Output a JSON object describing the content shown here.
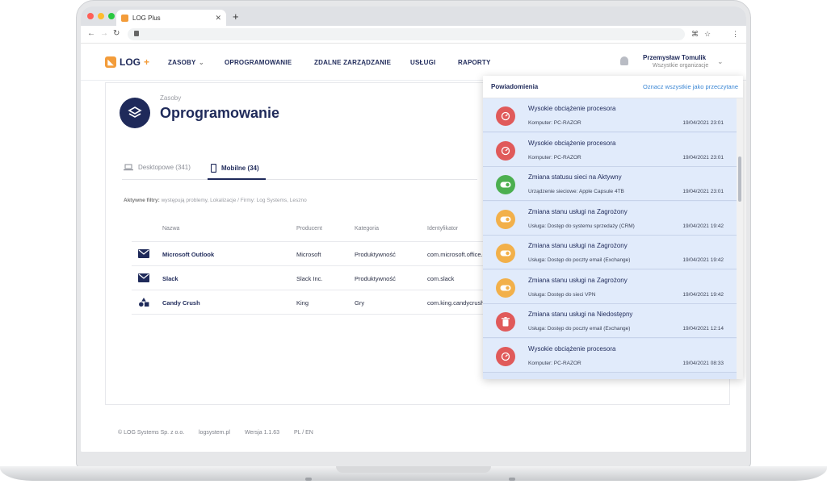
{
  "browser": {
    "tab_title": "LOG Plus",
    "new_tab": "+",
    "close_tab": "✕"
  },
  "header": {
    "logo_text": "LOG",
    "logo_plus": "+",
    "nav": [
      "ZASOBY",
      "OPROGRAMOWANIE",
      "ZDALNE ZARZĄDZANIE",
      "USŁUGI",
      "RAPORTY"
    ],
    "user_name": "Przemysław Tomulik",
    "user_org": "Wszystkie organizacje"
  },
  "page": {
    "breadcrumb": "Zasoby",
    "title": "Oprogramowanie",
    "tabs": [
      {
        "label": "Desktopowe (341)",
        "icon": "laptop-icon"
      },
      {
        "label": "Mobilne (34)",
        "icon": "phone-icon"
      }
    ],
    "filters_label": "Aktywne filtry:",
    "filters_value": "występują problemy, Lokalizacje / Firmy: Log Systems, Leszno"
  },
  "table": {
    "columns": [
      "Nazwa",
      "Producent",
      "Kategoria",
      "Identyfikator"
    ],
    "rows": [
      {
        "icon": "mail-icon",
        "name": "Microsoft Outlook",
        "producer": "Microsoft",
        "category": "Produktywność",
        "id": "com.microsoft.office.o"
      },
      {
        "icon": "mail-icon",
        "name": "Slack",
        "producer": "Slack Inc.",
        "category": "Produktywność",
        "id": "com.slack"
      },
      {
        "icon": "shapes-icon",
        "name": "Candy Crush",
        "producer": "King",
        "category": "Gry",
        "id": "com.king.candycrushs"
      }
    ]
  },
  "footer": {
    "copyright": "© LOG Systems Sp. z o.o.",
    "site": "logsystem.pl",
    "version": "Wersja 1.1.63",
    "lang": "PL / EN"
  },
  "notifications": {
    "title": "Powiadomienia",
    "mark_all": "Oznacz wszystkie jako przeczytane",
    "items": [
      {
        "icon": "gauge-icon",
        "color": "#e05a5a",
        "title": "Wysokie obciążenie procesora",
        "desc": "Komputer: PC-RAZOR",
        "date": "19/04/2021 23:01"
      },
      {
        "icon": "gauge-icon",
        "color": "#e05a5a",
        "title": "Wysokie obciążenie procesora",
        "desc": "Komputer: PC-RAZOR",
        "date": "19/04/2021 23:01"
      },
      {
        "icon": "toggle-icon",
        "color": "#4caf50",
        "title": "Zmiana statusu sieci na Aktywny",
        "desc": "Urządzenie sieciowe: Apple Capsule 4TB",
        "date": "19/04/2021 23:01"
      },
      {
        "icon": "toggle-icon",
        "color": "#f2b04a",
        "title": "Zmiana stanu usługi na Zagrożony",
        "desc": "Usługa: Dostęp do systemu sprzedaży (CRM)",
        "date": "19/04/2021 19:42"
      },
      {
        "icon": "toggle-icon",
        "color": "#f2b04a",
        "title": "Zmiana stanu usługi na Zagrożony",
        "desc": "Usługa: Dostęp do poczty email (Exchange)",
        "date": "19/04/2021 19:42"
      },
      {
        "icon": "toggle-icon",
        "color": "#f2b04a",
        "title": "Zmiana stanu usługi na Zagrożony",
        "desc": "Usługa: Dostęp do sieci VPN",
        "date": "19/04/2021 19:42"
      },
      {
        "icon": "trash-icon",
        "color": "#e05a5a",
        "title": "Zmiana stanu usługi na Niedostępny",
        "desc": "Usługa: Dostęp do poczty email (Exchange)",
        "date": "19/04/2021 12:14"
      },
      {
        "icon": "gauge-icon",
        "color": "#e05a5a",
        "title": "Wysokie obciążenie procesora",
        "desc": "Komputer: PC-RAZOR",
        "date": "19/04/2021 08:33"
      }
    ]
  },
  "colors": {
    "brand_navy": "#1f2a5a",
    "brand_orange": "#f39c3a",
    "notif_bg": "#e1ebfb",
    "link_blue": "#3a86d4"
  }
}
